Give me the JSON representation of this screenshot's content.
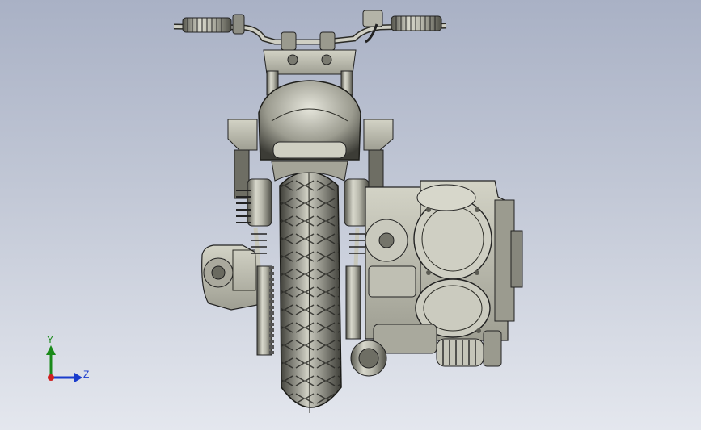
{
  "viewport": {
    "background_top": "#a9b1c5",
    "background_bottom": "#e4e7ee",
    "model_icon": "motorcycle-cad-model"
  },
  "triad": {
    "y_label": "Y",
    "z_label": "Z",
    "y_color": "#1a8a1a",
    "z_color": "#1a3ccc",
    "x_color": "#d02020"
  }
}
